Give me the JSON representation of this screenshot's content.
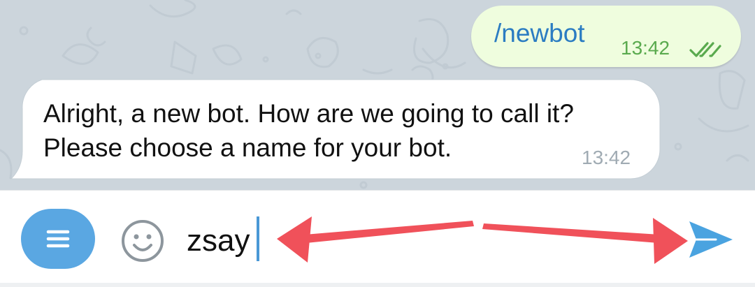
{
  "messages": [
    {
      "direction": "outgoing",
      "text": "/newbot",
      "time": "13:42",
      "status": "read-double-check"
    },
    {
      "direction": "incoming",
      "text": "Alright, a new bot. How are we going to call it? Please choose a name for your bot.",
      "time": "13:42"
    }
  ],
  "composer": {
    "value": "zsay",
    "menu_icon": "menu-icon",
    "emoji_icon": "smiley-icon",
    "send_icon": "send-icon"
  },
  "annotations": {
    "arrows": "double-headed red arrow between typed text and send button"
  },
  "colors": {
    "chat_background": "#ccd5dc",
    "outgoing_bubble": "#effdde",
    "incoming_bubble": "#ffffff",
    "command_link": "#2b7cc2",
    "outgoing_time": "#5aaa4e",
    "accent_blue": "#5aa7e2",
    "arrow_red": "#f0515a"
  }
}
